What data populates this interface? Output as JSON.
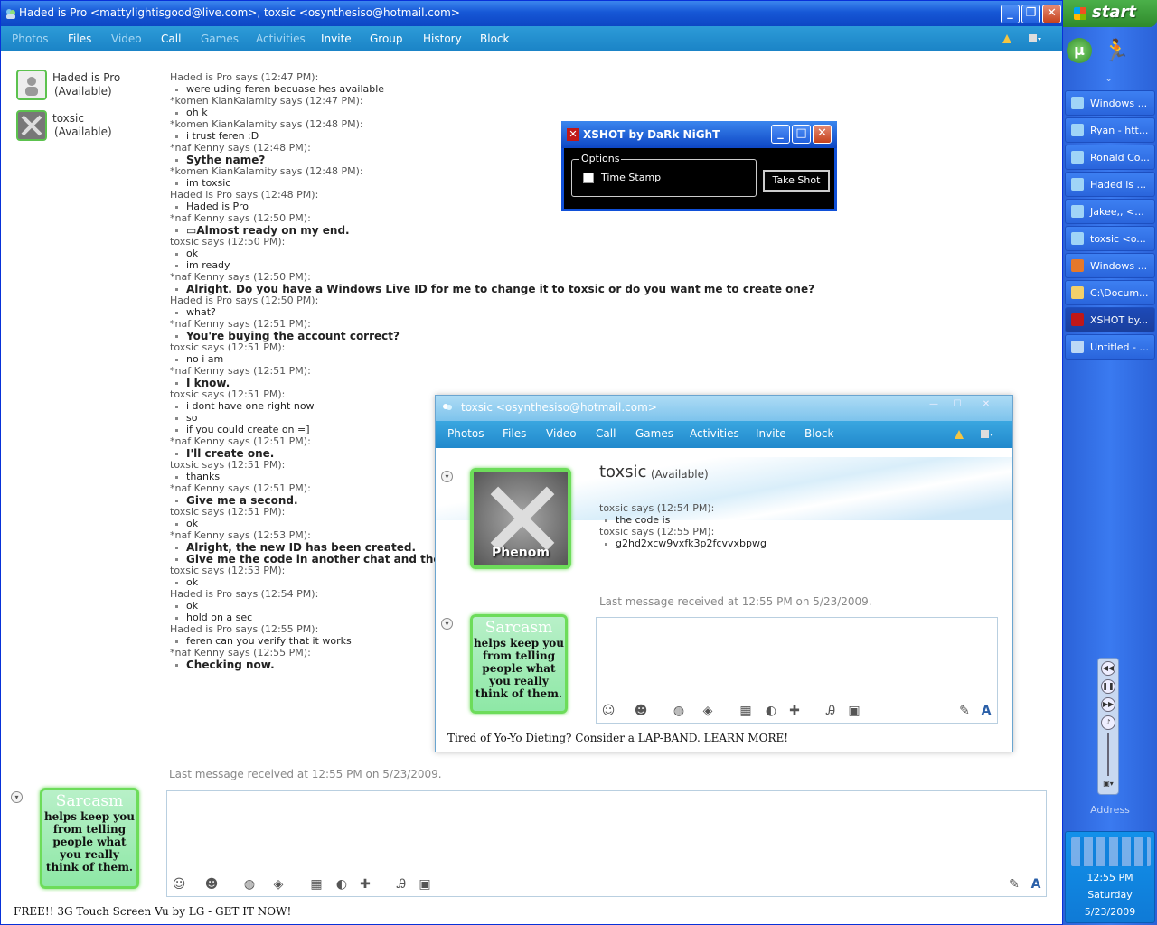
{
  "main": {
    "title": "Haded is Pro <mattylightisgood@live.com>, toxsic <osynthesiso@hotmail.com>",
    "menu": [
      "Photos",
      "Files",
      "Video",
      "Call",
      "Games",
      "Activities",
      "Invite",
      "Group",
      "History",
      "Block"
    ],
    "contacts": [
      {
        "name": "Haded is Pro",
        "status": "(Available)"
      },
      {
        "name": "toxsic",
        "status": "(Available)"
      }
    ],
    "chat": [
      {
        "k": "h",
        "t": "Haded is Pro says (12:47 PM):"
      },
      {
        "k": "m",
        "t": "were uding feren becuase hes available"
      },
      {
        "k": "h",
        "t": "*komen KianKalamity says (12:47 PM):"
      },
      {
        "k": "m",
        "t": "oh k"
      },
      {
        "k": "h",
        "t": "*komen KianKalamity says (12:48 PM):"
      },
      {
        "k": "m",
        "t": "i trust feren :D"
      },
      {
        "k": "hk",
        "t": "*naf Kenny says (12:48 PM):"
      },
      {
        "k": "b",
        "t": "Sythe name?"
      },
      {
        "k": "h",
        "t": "*komen KianKalamity says (12:48 PM):"
      },
      {
        "k": "m",
        "t": "im toxsic"
      },
      {
        "k": "h",
        "t": "Haded is Pro says (12:48 PM):"
      },
      {
        "k": "m",
        "t": "Haded is Pro"
      },
      {
        "k": "hk",
        "t": "*naf Kenny says (12:50 PM):"
      },
      {
        "k": "b",
        "t": "▭Almost ready on my end."
      },
      {
        "k": "h",
        "t": "toxsic says (12:50 PM):"
      },
      {
        "k": "m",
        "t": "ok"
      },
      {
        "k": "m",
        "t": "im ready"
      },
      {
        "k": "hk",
        "t": "*naf Kenny says (12:50 PM):"
      },
      {
        "k": "b",
        "t": "Alright. Do you have a Windows Live ID for me to change it to toxsic or do you want me to create one?"
      },
      {
        "k": "h",
        "t": "Haded is Pro says (12:50 PM):"
      },
      {
        "k": "m",
        "t": "what?"
      },
      {
        "k": "hk",
        "t": "*naf Kenny says (12:51 PM):"
      },
      {
        "k": "b",
        "t": "You're buying the account correct?"
      },
      {
        "k": "h",
        "t": "toxsic says (12:51 PM):"
      },
      {
        "k": "m",
        "t": "no i am"
      },
      {
        "k": "hk",
        "t": "*naf Kenny says (12:51 PM):"
      },
      {
        "k": "b",
        "t": "I know."
      },
      {
        "k": "h",
        "t": "toxsic says (12:51 PM):"
      },
      {
        "k": "m",
        "t": "i dont have one right now"
      },
      {
        "k": "m",
        "t": "so"
      },
      {
        "k": "m",
        "t": "if you could create on =]"
      },
      {
        "k": "hk",
        "t": "*naf Kenny says (12:51 PM):"
      },
      {
        "k": "b",
        "t": "I'll create one."
      },
      {
        "k": "h",
        "t": "toxsic says (12:51 PM):"
      },
      {
        "k": "m",
        "t": "thanks"
      },
      {
        "k": "hk",
        "t": "*naf Kenny says (12:51 PM):"
      },
      {
        "k": "b",
        "t": "Give me a second."
      },
      {
        "k": "h",
        "t": "toxsic says (12:51 PM):"
      },
      {
        "k": "m",
        "t": "ok"
      },
      {
        "k": "hk",
        "t": "*naf Kenny says (12:53 PM):"
      },
      {
        "k": "b",
        "t": "Alright, the new ID has been created."
      },
      {
        "k": "b",
        "t": "Give me the code in another chat and the accoun"
      },
      {
        "k": "h",
        "t": "toxsic says (12:53 PM):"
      },
      {
        "k": "m",
        "t": "ok"
      },
      {
        "k": "h",
        "t": "Haded is Pro says (12:54 PM):"
      },
      {
        "k": "m",
        "t": "ok"
      },
      {
        "k": "m",
        "t": "hold on a sec"
      },
      {
        "k": "h",
        "t": "Haded is Pro says (12:55 PM):"
      },
      {
        "k": "m",
        "t": "feren can you verify that it works"
      },
      {
        "k": "hk",
        "t": "*naf Kenny says (12:55 PM):"
      },
      {
        "k": "b",
        "t": "Checking now."
      }
    ],
    "last_message": "Last message received at 12:55 PM on 5/23/2009.",
    "ad": "FREE!! 3G Touch Screen Vu by LG - GET IT NOW!",
    "avatar_text": {
      "top": "Sarcasm",
      "body": "helps keep you from telling people what you really think of them."
    }
  },
  "xshot": {
    "title": "XSHOT by DaRk NiGhT",
    "options_label": "Options",
    "timestamp_label": "Time Stamp",
    "timestamp_checked": false,
    "take_shot": "Take Shot"
  },
  "chat2": {
    "title": "toxsic <osynthesiso@hotmail.com>",
    "menu": [
      "Photos",
      "Files",
      "Video",
      "Call",
      "Games",
      "Activities",
      "Invite",
      "Block"
    ],
    "contact_name": "toxsic",
    "contact_status": "(Available)",
    "avatar_label": "Phenom",
    "messages": [
      {
        "k": "h",
        "t": "toxsic says (12:54 PM):"
      },
      {
        "k": "m",
        "t": "the code is"
      },
      {
        "k": "h",
        "t": "toxsic says (12:55 PM):"
      },
      {
        "k": "m",
        "t": "g2hd2xcw9vxfk3p2fcvvxbpwg"
      }
    ],
    "last_message": "Last message received at 12:55 PM on 5/23/2009.",
    "ad": "Tired of Yo-Yo Dieting? Consider a LAP-BAND. LEARN MORE!",
    "avatar_text": {
      "top": "Sarcasm",
      "body": "helps keep you from telling people what you really think of them."
    }
  },
  "taskbar": {
    "start": "start",
    "tasks": [
      {
        "label": "Windows ...",
        "color": "#9fd4f7"
      },
      {
        "label": "Ryan - htt...",
        "color": "#9fd4f7"
      },
      {
        "label": "Ronald Co...",
        "color": "#9fd4f7"
      },
      {
        "label": "Haded is ...",
        "color": "#9fd4f7"
      },
      {
        "label": "Jakee,, <...",
        "color": "#9fd4f7"
      },
      {
        "label": "toxsic <o...",
        "color": "#9fd4f7"
      },
      {
        "label": "Windows ...",
        "color": "#e6782a"
      },
      {
        "label": "C:\\Docum...",
        "color": "#f3d06a"
      },
      {
        "label": "XSHOT by...",
        "color": "#c01818"
      },
      {
        "label": "Untitled - ...",
        "color": "#bcd8f6"
      }
    ],
    "active_task": 8,
    "address_label": "Address",
    "clock": "12:55 PM",
    "day": "Saturday",
    "date": "5/23/2009"
  }
}
